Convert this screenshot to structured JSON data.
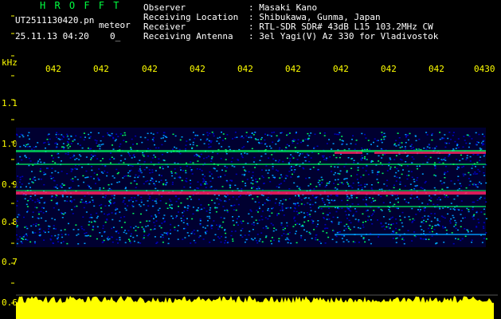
{
  "header": {
    "brand": "H R O F F T",
    "filename": "UT2511130420.pn",
    "mode": "meteor",
    "datetime": "25.11.13 04:20",
    "dim": "0_",
    "info": [
      {
        "label": "Observer",
        "value": ": Masaki Kano"
      },
      {
        "label": "Receiving Location",
        "value": ": Shibukawa, Gunma, Japan"
      },
      {
        "label": "Receiver",
        "value": ": RTL-SDR SDR# 43dB L15 103.2MHz CW"
      },
      {
        "label": "Receiving Antenna",
        "value": ": 3el Yagi(V) Az 330 for Vladivostok"
      }
    ]
  },
  "axes": {
    "y_unit": "kHz",
    "y_ticks": [
      "1.1",
      "1.0",
      "0.9",
      "0.8",
      "0.7",
      "0.6"
    ],
    "x_ticks": [
      "042",
      "042",
      "042",
      "042",
      "042",
      "042",
      "042",
      "042",
      "042",
      "0430"
    ]
  },
  "colors": {
    "background": "#000000",
    "text": "#ffff00",
    "brand": "#00ff40",
    "noise_low": "#0000c0",
    "noise_mid": "#00a0ff",
    "signal": "#00ff60",
    "strong": "#ff2060",
    "meter": "#ffff00"
  }
}
